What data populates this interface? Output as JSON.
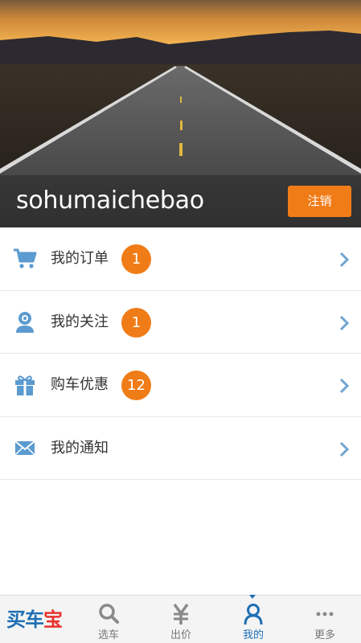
{
  "profile": {
    "username": "sohumaichebao",
    "logout_label": "注销"
  },
  "menu": {
    "items": [
      {
        "label": "我的订单",
        "badge": "1",
        "icon": "cart-icon"
      },
      {
        "label": "我的关注",
        "badge": "1",
        "icon": "follow-icon"
      },
      {
        "label": "购车优惠",
        "badge": "12",
        "icon": "gift-icon"
      },
      {
        "label": "我的通知",
        "badge": "",
        "icon": "mail-icon"
      }
    ]
  },
  "tabbar": {
    "brand": [
      "买",
      "车",
      "宝"
    ],
    "tabs": [
      {
        "label": "选车",
        "icon": "search-icon"
      },
      {
        "label": "出价",
        "icon": "yen-icon"
      },
      {
        "label": "我的",
        "icon": "user-icon",
        "active": true
      },
      {
        "label": "更多",
        "icon": "more-icon"
      }
    ]
  },
  "colors": {
    "accent": "#f07c18",
    "primary": "#1f6fb4",
    "icon": "#5b9bd0"
  }
}
